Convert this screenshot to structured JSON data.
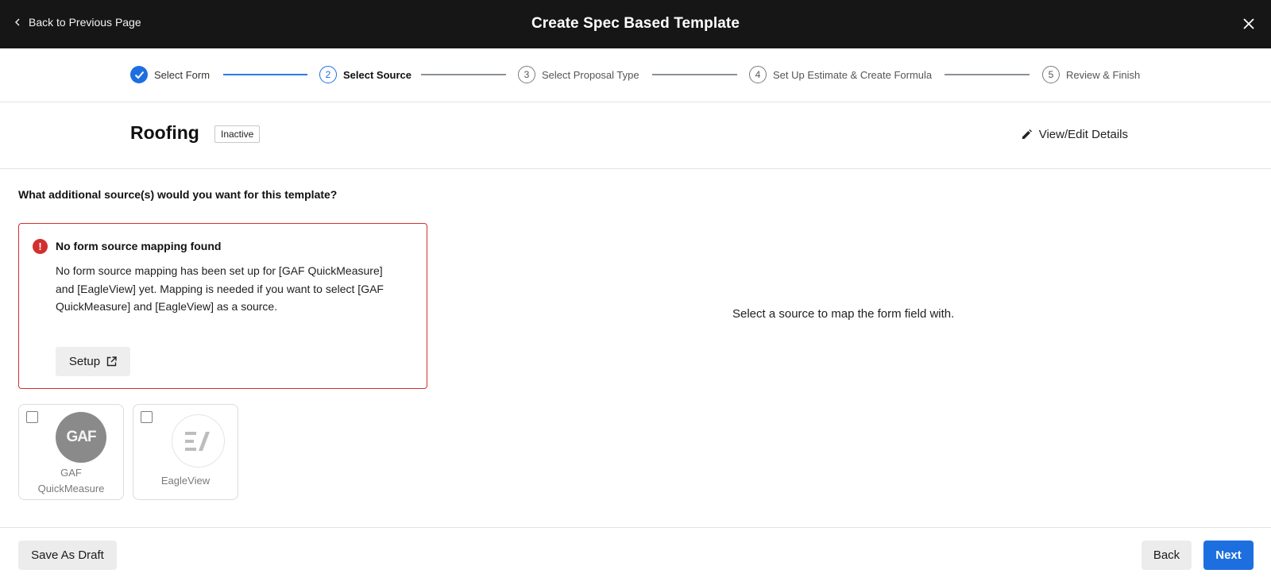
{
  "topbar": {
    "back_label": "Back to Previous Page",
    "title": "Create Spec Based Template"
  },
  "stepper": {
    "steps": [
      {
        "number": "1",
        "label": "Select Form",
        "state": "done"
      },
      {
        "number": "2",
        "label": "Select Source",
        "state": "active"
      },
      {
        "number": "3",
        "label": "Select Proposal Type",
        "state": "pending"
      },
      {
        "number": "4",
        "label": "Set Up Estimate & Create Formula",
        "state": "pending"
      },
      {
        "number": "5",
        "label": "Review & Finish",
        "state": "pending"
      }
    ]
  },
  "header": {
    "title": "Roofing",
    "status": "Inactive",
    "view_edit_label": "View/Edit Details"
  },
  "question": "What additional source(s) would you want for this template?",
  "alert": {
    "icon": "!",
    "title": "No form source mapping found",
    "body": "No form source mapping has been set up for [GAF QuickMeasure] and [EagleView] yet. Mapping is needed if you want to select [GAF QuickMeasure] and [EagleView] as a source.",
    "setup_label": "Setup"
  },
  "sources": [
    {
      "logo_text": "GAF",
      "label_line1": "GAF",
      "label_line2": "QuickMeasure",
      "checked": false
    },
    {
      "logo_text": "",
      "label_line1": "EagleView",
      "checked": false
    }
  ],
  "placeholder": "Select a source to map the form field with.",
  "footer": {
    "save_draft_label": "Save As Draft",
    "back_label": "Back",
    "next_label": "Next"
  },
  "colors": {
    "accent": "#1d6fe0",
    "error": "#d32f2f",
    "topbar": "#161616"
  }
}
